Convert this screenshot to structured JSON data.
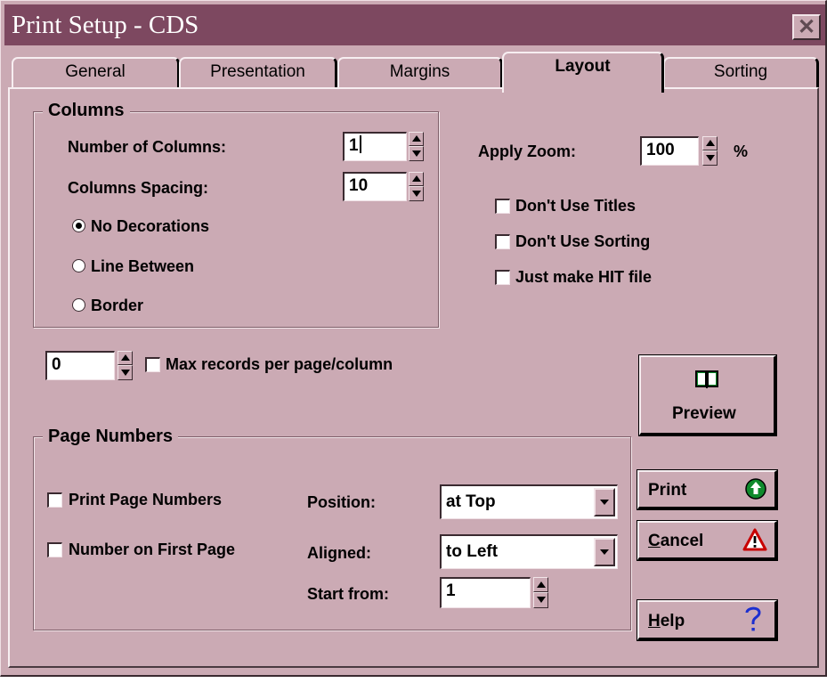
{
  "window": {
    "title": "Print Setup - CDS",
    "close_glyph": "✕"
  },
  "tabs": [
    {
      "label": "General",
      "active": false
    },
    {
      "label": "Presentation",
      "active": false
    },
    {
      "label": "Margins",
      "active": false
    },
    {
      "label": "Layout",
      "active": true
    },
    {
      "label": "Sorting",
      "active": false
    }
  ],
  "columns": {
    "group_label": "Columns",
    "number_label": "Number of Columns:",
    "number_value": "1",
    "spacing_label": "Columns Spacing:",
    "spacing_value": "10",
    "decorations": [
      {
        "label": "No Decorations",
        "selected": true
      },
      {
        "label": "Line Between",
        "selected": false
      },
      {
        "label": "Border",
        "selected": false
      }
    ]
  },
  "zoom": {
    "label": "Apply Zoom:",
    "value": "100",
    "unit": "%"
  },
  "options": [
    {
      "label": "Don't Use Titles",
      "checked": false
    },
    {
      "label": "Don't Use Sorting",
      "checked": false
    },
    {
      "label": "Just make HIT file",
      "checked": false
    }
  ],
  "max_records": {
    "value": "0",
    "label": "Max records per page/column",
    "checked": false
  },
  "page_numbers": {
    "group_label": "Page Numbers",
    "print_label": "Print Page Numbers",
    "first_page_label": "Number on First Page",
    "position_label": "Position:",
    "position_value": "at Top",
    "aligned_label": "Aligned:",
    "aligned_value": "to Left",
    "start_label": "Start from:",
    "start_value": "1"
  },
  "buttons": {
    "preview": "Preview",
    "print": "Print",
    "cancel_mnemonic": "C",
    "cancel_rest": "ancel",
    "help_mnemonic": "H",
    "help_rest": "elp"
  },
  "icons": {
    "preview": "book-icon",
    "print": "green-up-arrow-icon",
    "cancel": "warning-icon",
    "help": "question-mark-icon"
  },
  "colors": {
    "dialog_bg": "#cbaab4",
    "titlebar": "#7d4860",
    "print_icon": "#0f8a2c",
    "warning_icon": "#c80000",
    "help_icon": "#1c2fd0"
  }
}
